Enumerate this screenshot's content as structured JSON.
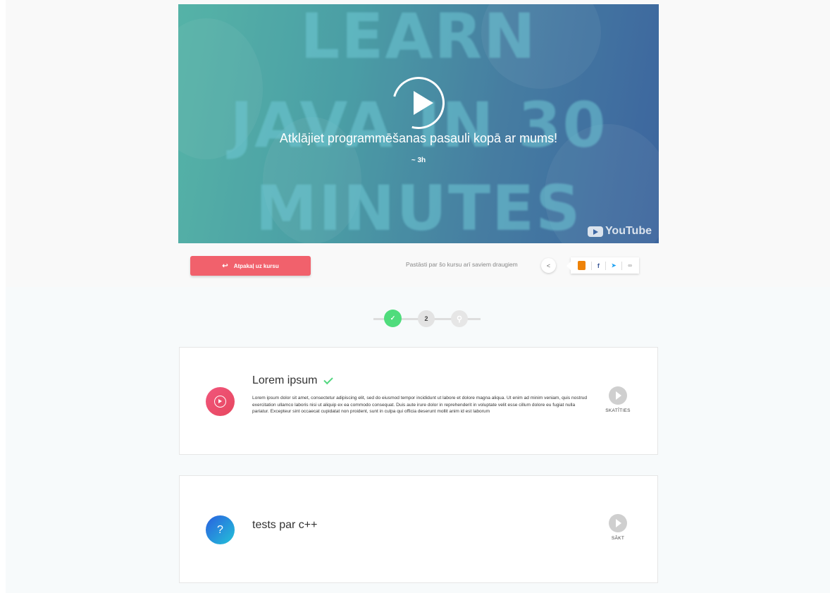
{
  "video": {
    "bg_words": [
      "LEARN",
      "JAVA IN 30",
      "MINUTES"
    ],
    "title": "Atklājiet programmēšanas pasauli kopā ar mums!",
    "duration": "~ 3h",
    "provider_label": "YouTube"
  },
  "actions": {
    "back_label": "Atpakaļ uz kursu",
    "back_icon": "↩",
    "share_text": "Pastāsti par šo kursu arī saviem draugiem",
    "share_icon": "<",
    "share_items": [
      {
        "name": "odnoklassniki",
        "glyph": "ok"
      },
      {
        "name": "facebook",
        "glyph": "f"
      },
      {
        "name": "twitter",
        "glyph": "t"
      },
      {
        "name": "link",
        "glyph": "∞"
      }
    ]
  },
  "stepper": {
    "steps": [
      {
        "state": "done",
        "label": "✓"
      },
      {
        "state": "current",
        "label": "2"
      },
      {
        "state": "final",
        "label": "🏆"
      }
    ]
  },
  "lessons": [
    {
      "title": "Lorem ipsum",
      "completed": true,
      "description": "Lorem ipsum dolor sit amet, consectetur adipiscing elit, sed do eiusmod tempor incididunt ut labore et dolore magna aliqua. Ut enim ad minim veniam, quis nostrud exercitation ullamco laboris nisi ut aliquip ex ea commodo consequat. Duis aute irure dolor in reprehenderit in voluptate velit esse cillum dolore eu fugiat nulla pariatur. Excepteur sint occaecat cupidatat non proident, sunt in culpa qui officia deserunt mollit anim id est laborum",
      "action_label": "SKATĪTIES",
      "icon": "play-circle-icon"
    },
    {
      "title": "tests par c++",
      "completed": false,
      "description": "",
      "action_label": "SĀKT",
      "icon": "question-icon",
      "icon_glyph": "?"
    }
  ],
  "colors": {
    "accent_red": "#f1616c",
    "success_green": "#4fdc7c",
    "quiz_gradient_start": "#2a5fe0",
    "quiz_gradient_end": "#23c3d8"
  }
}
